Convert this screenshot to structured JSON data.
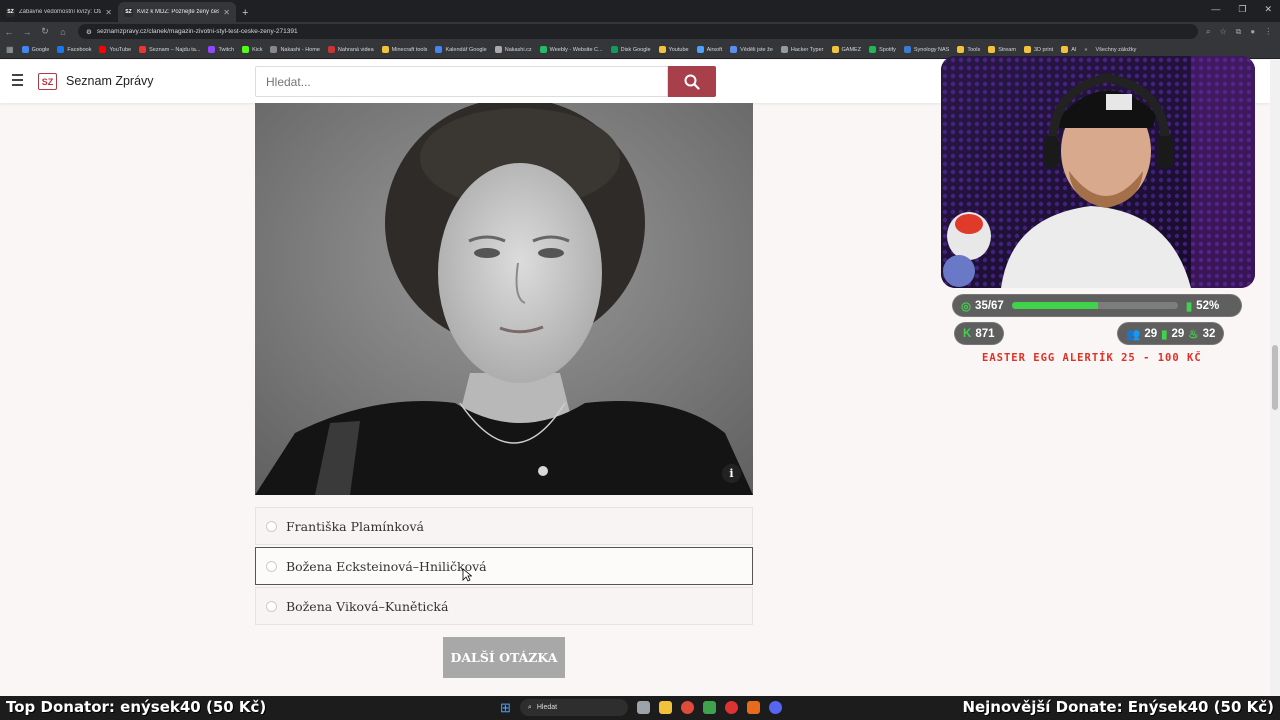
{
  "browser": {
    "tabs": [
      {
        "favicon": "SZ",
        "title": "Zábavné vědomostní kvízy: Otá..."
      },
      {
        "favicon": "SZ",
        "title": "Kvíz k MDŽ: Poznejte ženy česk..."
      }
    ],
    "url": "seznamzpravy.cz/clanek/magazin-zivotni-styl-test-ceske-zeny-271391",
    "bookmarks": [
      "Google",
      "Facebook",
      "YouTube",
      "Seznam – Najdu ta...",
      "Twitch",
      "Kick",
      "Nakashi - Home",
      "Nahraná videa",
      "Minecraft tools",
      "Kalendář Google",
      "Nakashi.cz",
      "Weebly - Website C...",
      "Disk Google",
      "Youtube",
      "Airsoft",
      "Věděli jste že",
      "Hacker Typer",
      "GAMEZ",
      "Spotify",
      "Synology NAS",
      "Tools",
      "Stream",
      "3D print",
      "AI"
    ],
    "bookmarks_overflow": "»",
    "all_bookmarks": "Všechny záložky"
  },
  "site": {
    "logo": "SZ",
    "name": "Seznam Zprávy",
    "search_placeholder": "Hledat..."
  },
  "quiz": {
    "info_label": "i",
    "answers": [
      {
        "label": "Františka Plamínková",
        "hovered": false
      },
      {
        "label": "Božena Eckstein­ová–Hniličková",
        "hovered": true
      },
      {
        "label": "Božena Viková–Kunětická",
        "hovered": false
      }
    ],
    "next_button": "DALŠÍ OTÁZKA"
  },
  "overlay": {
    "progress_text": "35/67",
    "progress_value": 0.52,
    "percent_text": "52%",
    "points": "871",
    "stat_a": "29",
    "stat_b": "29",
    "stat_c": "32",
    "easter_egg": "EASTER EGG ALERTÍK 25 - 100 KČ",
    "colors": {
      "green": "#3fd24a",
      "alert_red": "#e03024"
    }
  },
  "ticker": {
    "left": "Top Donator: enýsek40 (50 Kč)",
    "right": "Nejnovější Donate: Enýsek40 (50 Kč)"
  },
  "taskbar": {
    "search": "Hledat"
  },
  "colors": {
    "brand": "#a8404c",
    "page_bg": "#fbf6f6"
  }
}
